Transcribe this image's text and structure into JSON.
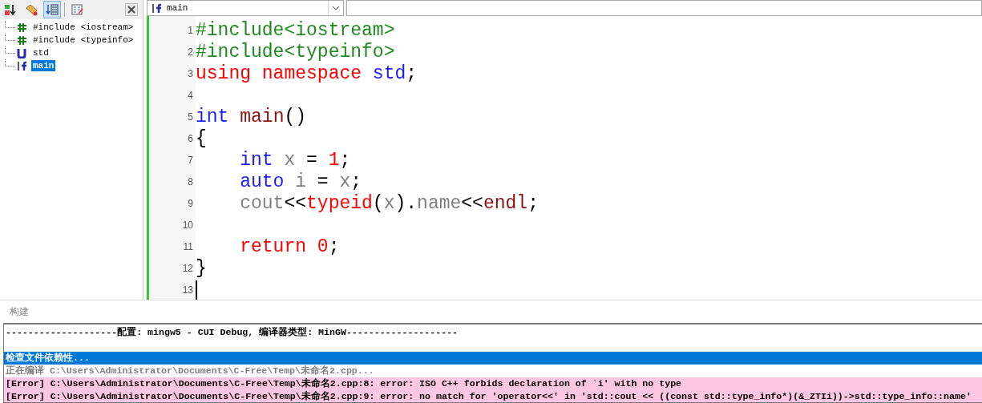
{
  "class_browser": {
    "toolbar": [
      {
        "kind": "sort",
        "selected": false
      },
      {
        "kind": "tag",
        "selected": false
      },
      {
        "kind": "list",
        "selected": true
      },
      {
        "kind": "report",
        "selected": false
      }
    ],
    "items": [
      {
        "kind": "include",
        "label": "#include <iostream>",
        "selected": false
      },
      {
        "kind": "include",
        "label": "#include <typeinfo>",
        "selected": false
      },
      {
        "kind": "namespace",
        "label": "std",
        "selected": false
      },
      {
        "kind": "function",
        "label": "main",
        "selected": true
      }
    ]
  },
  "editor": {
    "function_combo": {
      "value": "main"
    },
    "lines": [
      {
        "number": "1",
        "tokens": [
          {
            "kind": "preproc",
            "text": "#include<iostream>"
          }
        ]
      },
      {
        "number": "2",
        "tokens": [
          {
            "kind": "preproc",
            "text": "#include<typeinfo>"
          }
        ]
      },
      {
        "number": "3",
        "tokens": [
          {
            "kind": "keyword",
            "text": "using namespace "
          },
          {
            "kind": "type",
            "text": "std"
          },
          {
            "kind": "plain",
            "text": ";"
          }
        ]
      },
      {
        "number": "4"
      },
      {
        "number": "5",
        "tokens": [
          {
            "kind": "type",
            "text": "int "
          },
          {
            "kind": "func",
            "text": "main"
          },
          {
            "kind": "plain",
            "text": "()"
          }
        ]
      },
      {
        "number": "6",
        "tokens": [
          {
            "kind": "plain",
            "text": "{"
          }
        ]
      },
      {
        "number": "7",
        "tokens": [
          {
            "kind": "type",
            "text": "    int "
          },
          {
            "kind": "ident",
            "text": "x"
          },
          {
            "kind": "plain",
            "text": " = "
          },
          {
            "kind": "number",
            "text": "1"
          },
          {
            "kind": "plain",
            "text": ";"
          }
        ]
      },
      {
        "number": "8",
        "tokens": [
          {
            "kind": "type",
            "text": "    auto "
          },
          {
            "kind": "ident",
            "text": "i"
          },
          {
            "kind": "plain",
            "text": " = "
          },
          {
            "kind": "ident",
            "text": "x"
          },
          {
            "kind": "plain",
            "text": ";"
          }
        ]
      },
      {
        "number": "9",
        "tokens": [
          {
            "kind": "ident",
            "text": "    cout"
          },
          {
            "kind": "plain",
            "text": "<<"
          },
          {
            "kind": "keyword",
            "text": "typeid"
          },
          {
            "kind": "plain",
            "text": "("
          },
          {
            "kind": "ident",
            "text": "x"
          },
          {
            "kind": "plain",
            "text": ")."
          },
          {
            "kind": "ident",
            "text": "name"
          },
          {
            "kind": "plain",
            "text": "<<"
          },
          {
            "kind": "func",
            "text": "endl"
          },
          {
            "kind": "plain",
            "text": ";"
          }
        ]
      },
      {
        "number": "10"
      },
      {
        "number": "11",
        "tokens": [
          {
            "kind": "keyword",
            "text": "    return "
          },
          {
            "kind": "number",
            "text": "0"
          },
          {
            "kind": "plain",
            "text": ";"
          }
        ]
      },
      {
        "number": "12",
        "tokens": [
          {
            "kind": "plain",
            "text": "}"
          }
        ]
      },
      {
        "number": "13",
        "cursor": true
      }
    ]
  },
  "build": {
    "title": "构建",
    "lines": [
      {
        "kind": "header",
        "text": "--------------------配置: mingw5 - CUI Debug, 编译器类型: MinGW--------------------",
        "selected": false
      },
      {
        "kind": "info",
        "text": "检查文件依赖性...",
        "selected": true
      },
      {
        "kind": "info",
        "text": "正在编译 C:\\Users\\Administrator\\Documents\\C-Free\\Temp\\未命名2.cpp...",
        "selected": false
      },
      {
        "kind": "error",
        "text": "[Error] C:\\Users\\Administrator\\Documents\\C-Free\\Temp\\未命名2.cpp:8: error: ISO C++ forbids declaration of `i' with no type",
        "selected": false
      },
      {
        "kind": "error",
        "text": "[Error] C:\\Users\\Administrator\\Documents\\C-Free\\Temp\\未命名2.cpp:9: error: no match for 'operator<<' in 'std::cout << ((const std::type_info*)(&_ZTIi))->std::type_info::name'",
        "selected": false
      }
    ]
  }
}
